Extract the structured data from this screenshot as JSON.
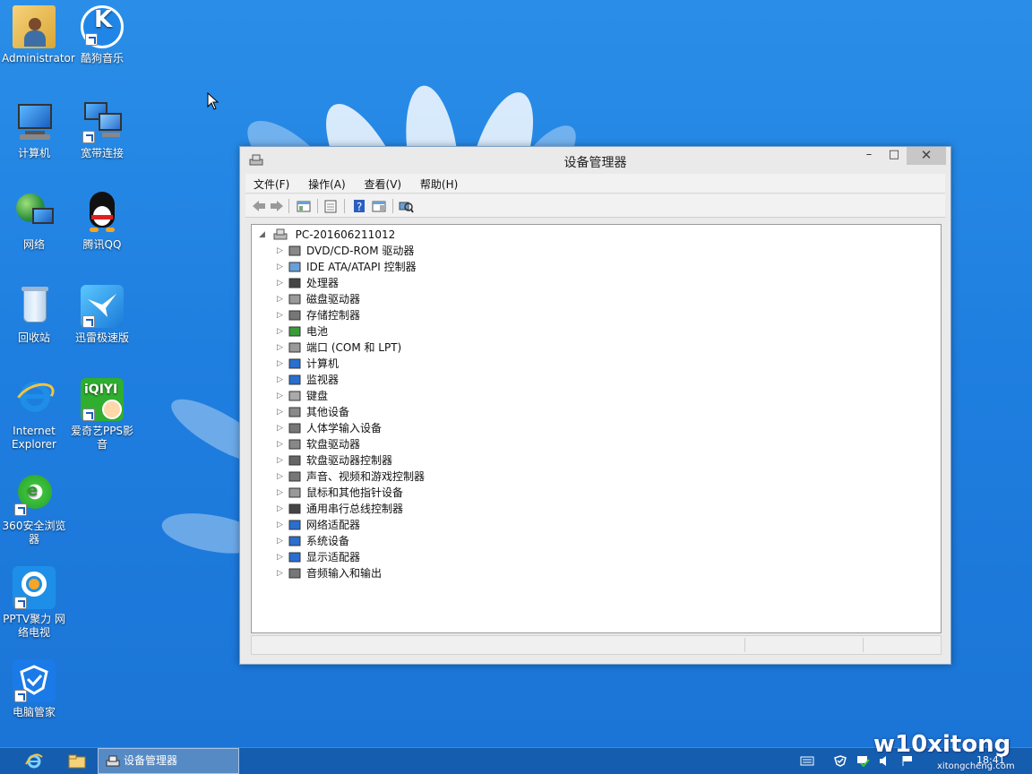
{
  "desktop": {
    "icons": [
      {
        "label": "Administrator",
        "icon": "user-folder-icon"
      },
      {
        "label": "酷狗音乐",
        "icon": "kugou-icon"
      },
      {
        "label": "计算机",
        "icon": "computer-icon"
      },
      {
        "label": "宽带连接",
        "icon": "network-connection-icon"
      },
      {
        "label": "网络",
        "icon": "network-globe-icon"
      },
      {
        "label": "腾讯QQ",
        "icon": "qq-penguin-icon"
      },
      {
        "label": "回收站",
        "icon": "recycle-bin-icon"
      },
      {
        "label": "迅雷极速版",
        "icon": "xunlei-bird-icon"
      },
      {
        "label": "Internet Explorer",
        "icon": "ie-icon"
      },
      {
        "label": "爱奇艺PPS影音",
        "icon": "iqiyi-icon"
      },
      {
        "label": "360安全浏览器",
        "icon": "360-browser-icon"
      },
      {
        "label": "PPTV聚力 网络电视",
        "icon": "pptv-icon"
      },
      {
        "label": "电脑管家",
        "icon": "shield-manager-icon"
      }
    ]
  },
  "window": {
    "title": "设备管理器",
    "minimize": "–",
    "maximize": "□",
    "close": "✕",
    "menu": [
      "文件(F)",
      "操作(A)",
      "查看(V)",
      "帮助(H)"
    ],
    "tree": {
      "root": "PC-201606211012",
      "items": [
        "DVD/CD-ROM 驱动器",
        "IDE ATA/ATAPI 控制器",
        "处理器",
        "磁盘驱动器",
        "存储控制器",
        "电池",
        "端口 (COM 和 LPT)",
        "计算机",
        "监视器",
        "键盘",
        "其他设备",
        "人体学输入设备",
        "软盘驱动器",
        "软盘驱动器控制器",
        "声音、视频和游戏控制器",
        "鼠标和其他指针设备",
        "通用串行总线控制器",
        "网络适配器",
        "系统设备",
        "显示适配器",
        "音频输入和输出"
      ]
    }
  },
  "taskbar": {
    "active_task": "设备管理器",
    "clock": "18:41"
  },
  "watermark": {
    "main": "w10xitong",
    "sub": "xitongcheng.com"
  }
}
